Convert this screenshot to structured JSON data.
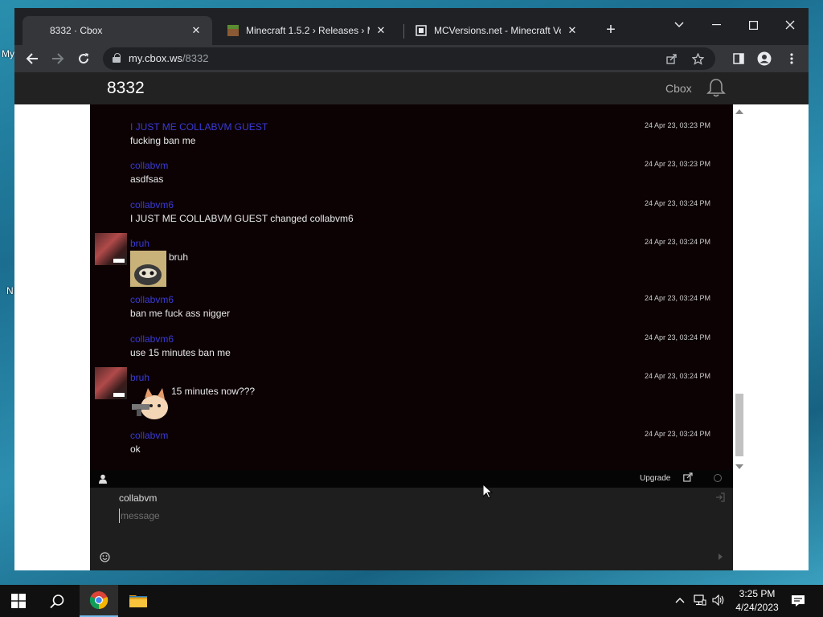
{
  "desktop": {
    "fragments": [
      "My",
      "N"
    ]
  },
  "browser": {
    "tabs": [
      {
        "title": "8332 · Cbox",
        "active": true,
        "close": "✕"
      },
      {
        "title": "Minecraft 1.5.2 › Releases › MC-F",
        "active": false,
        "close": "✕"
      },
      {
        "title": "MCVersions.net - Minecraft Versi",
        "active": false,
        "close": "✕"
      }
    ],
    "new_tab": "+",
    "url_host": "my.cbox.ws",
    "url_path": "/8332"
  },
  "cbox": {
    "title": "8332",
    "brand_link": "Cbox",
    "messages": [
      {
        "name": "I JUST ME COLLABVM GUEST",
        "body": "fucking ban me",
        "date": "24 Apr 23, 03:23 PM"
      },
      {
        "name": "collabvm",
        "body": "asdfsas",
        "date": "24 Apr 23, 03:23 PM"
      },
      {
        "name": "collabvm6",
        "body": "I JUST ME COLLABVM GUEST changed collabvm6",
        "date": "24 Apr 23, 03:24 PM"
      },
      {
        "name": "bruh",
        "body": "bruh",
        "date": "24 Apr 23, 03:24 PM"
      },
      {
        "name": "collabvm6",
        "body": "ban me fuck ass nigger",
        "date": "24 Apr 23, 03:24 PM"
      },
      {
        "name": "collabvm6",
        "body": "use 15 minutes ban me",
        "date": "24 Apr 23, 03:24 PM"
      },
      {
        "name": "bruh",
        "body": "15 minutes now???",
        "date": "24 Apr 23, 03:24 PM"
      },
      {
        "name": "collabvm",
        "body": "ok",
        "date": "24 Apr 23, 03:24 PM"
      }
    ],
    "footer_upgrade": "Upgrade",
    "compose_name": "collabvm",
    "compose_placeholder": "message"
  },
  "taskbar": {
    "time": "3:25 PM",
    "date": "4/24/2023"
  },
  "colors": {
    "chat_bg": "#0c0204",
    "username": "#3a3ad6",
    "taskbar_accent": "#76b9ed"
  }
}
